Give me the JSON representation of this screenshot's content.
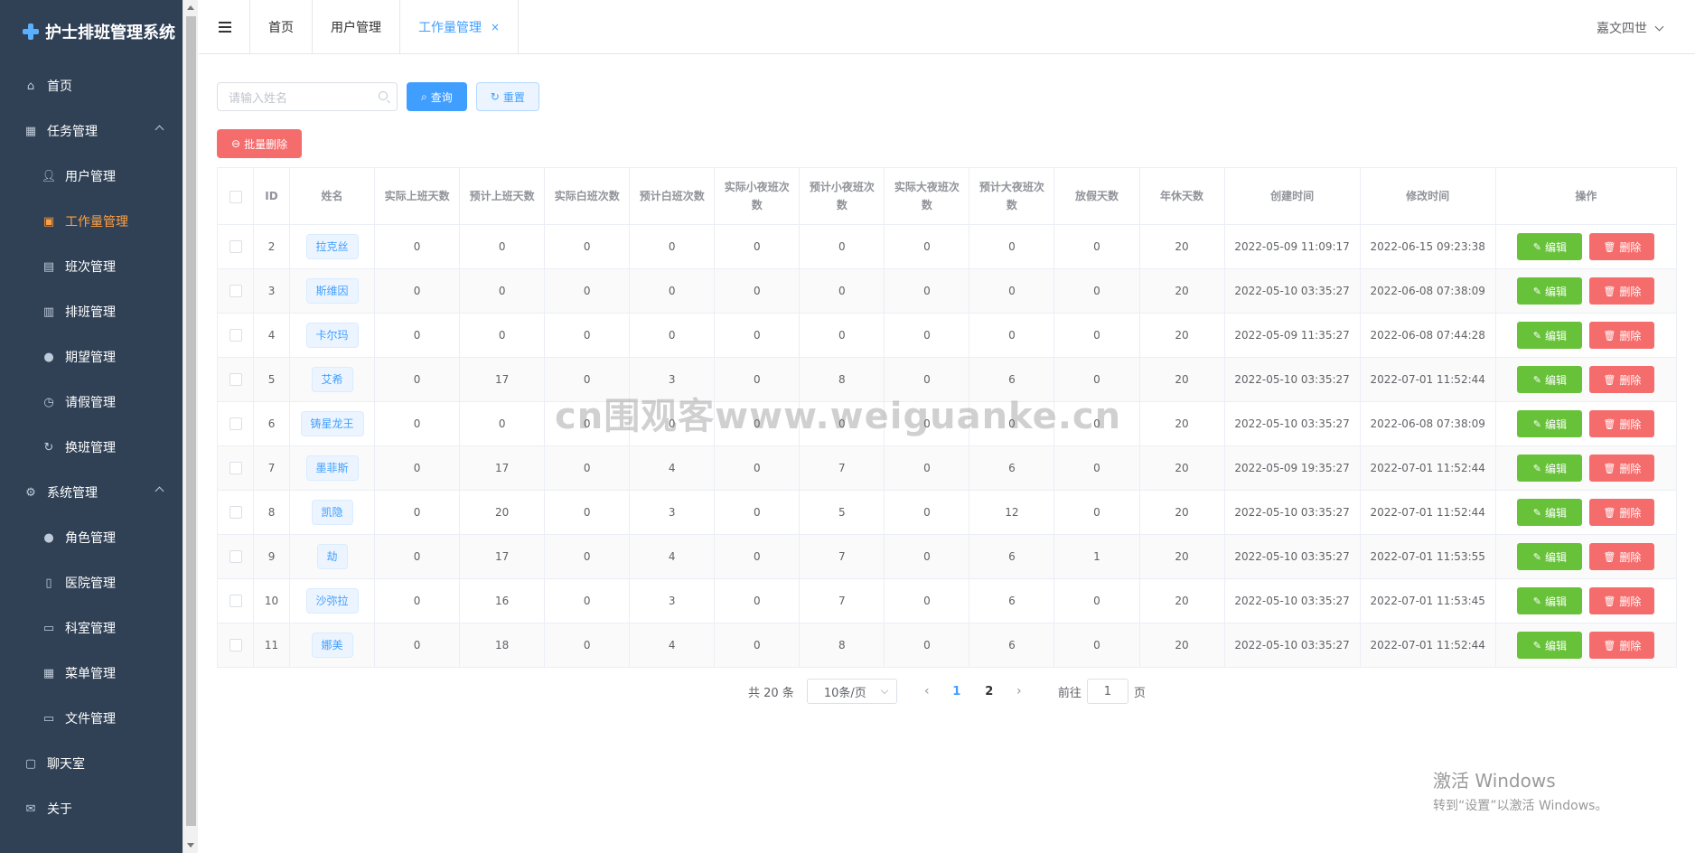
{
  "app": {
    "title": "护士排班管理系统"
  },
  "sidebar": {
    "items": [
      {
        "label": "首页",
        "icon": "home-icon"
      },
      {
        "label": "任务管理",
        "icon": "grid-icon"
      },
      {
        "label": "用户管理",
        "icon": "user-icon"
      },
      {
        "label": "工作量管理",
        "icon": "clipboard-icon"
      },
      {
        "label": "班次管理",
        "icon": "clipboard-icon"
      },
      {
        "label": "排班管理",
        "icon": "calendar-icon"
      },
      {
        "label": "期望管理",
        "icon": "location-icon"
      },
      {
        "label": "请假管理",
        "icon": "clock-icon"
      },
      {
        "label": "换班管理",
        "icon": "refresh-icon"
      },
      {
        "label": "系统管理",
        "icon": "gear-icon"
      },
      {
        "label": "角色管理",
        "icon": "user-icon"
      },
      {
        "label": "医院管理",
        "icon": "building-icon"
      },
      {
        "label": "科室管理",
        "icon": "office-icon"
      },
      {
        "label": "菜单管理",
        "icon": "menu-grid-icon"
      },
      {
        "label": "文件管理",
        "icon": "folder-icon"
      },
      {
        "label": "聊天室",
        "icon": "chat-icon"
      },
      {
        "label": "关于",
        "icon": "mail-icon"
      }
    ]
  },
  "header": {
    "tabs": [
      "首页",
      "用户管理",
      "工作量管理"
    ],
    "close_glyph": "×",
    "user": "嘉文四世"
  },
  "search": {
    "placeholder": "请输入姓名",
    "query_label": "查询",
    "reset_label": "重置"
  },
  "batch_delete_label": "批量删除",
  "table": {
    "columns": [
      "ID",
      "姓名",
      "实际上班天数",
      "预计上班天数",
      "实际白班次数",
      "预计白班次数",
      "实际小夜班次数",
      "预计小夜班次数",
      "实际大夜班次数",
      "预计大夜班次数",
      "放假天数",
      "年休天数",
      "创建时间",
      "修改时间",
      "操作"
    ],
    "edit_label": "编辑",
    "delete_label": "删除",
    "rows": [
      [
        "2",
        "拉克丝",
        "0",
        "0",
        "0",
        "0",
        "0",
        "0",
        "0",
        "0",
        "0",
        "20",
        "2022-05-09 11:09:17",
        "2022-06-15 09:23:38"
      ],
      [
        "3",
        "斯维因",
        "0",
        "0",
        "0",
        "0",
        "0",
        "0",
        "0",
        "0",
        "0",
        "20",
        "2022-05-10 03:35:27",
        "2022-06-08 07:38:09"
      ],
      [
        "4",
        "卡尔玛",
        "0",
        "0",
        "0",
        "0",
        "0",
        "0",
        "0",
        "0",
        "0",
        "20",
        "2022-05-09 11:35:27",
        "2022-06-08 07:44:28"
      ],
      [
        "5",
        "艾希",
        "0",
        "17",
        "0",
        "3",
        "0",
        "8",
        "0",
        "6",
        "0",
        "20",
        "2022-05-10 03:35:27",
        "2022-07-01 11:52:44"
      ],
      [
        "6",
        "铸星龙王",
        "0",
        "0",
        "0",
        "0",
        "0",
        "0",
        "0",
        "0",
        "0",
        "20",
        "2022-05-10 03:35:27",
        "2022-06-08 07:38:09"
      ],
      [
        "7",
        "墨菲斯",
        "0",
        "17",
        "0",
        "4",
        "0",
        "7",
        "0",
        "6",
        "0",
        "20",
        "2022-05-09 19:35:27",
        "2022-07-01 11:52:44"
      ],
      [
        "8",
        "凯隐",
        "0",
        "20",
        "0",
        "3",
        "0",
        "5",
        "0",
        "12",
        "0",
        "20",
        "2022-05-10 03:35:27",
        "2022-07-01 11:52:44"
      ],
      [
        "9",
        "劫",
        "0",
        "17",
        "0",
        "4",
        "0",
        "7",
        "0",
        "6",
        "1",
        "20",
        "2022-05-10 03:35:27",
        "2022-07-01 11:53:55"
      ],
      [
        "10",
        "沙弥拉",
        "0",
        "16",
        "0",
        "3",
        "0",
        "7",
        "0",
        "6",
        "0",
        "20",
        "2022-05-10 03:35:27",
        "2022-07-01 11:53:45"
      ],
      [
        "11",
        "娜美",
        "0",
        "18",
        "0",
        "4",
        "0",
        "8",
        "0",
        "6",
        "0",
        "20",
        "2022-05-10 03:35:27",
        "2022-07-01 11:52:44"
      ]
    ]
  },
  "pagination": {
    "total": "共 20 条",
    "page_size": "10条/页",
    "pages": [
      "1",
      "2"
    ],
    "current": "1",
    "goto_label": "前往",
    "goto_value": "1",
    "page_suffix": "页"
  },
  "watermark": "cn围观客www.weiguanke.cn",
  "activate": {
    "line1": "激活 Windows",
    "line2": "转到“设置”以激活 Windows。"
  },
  "colors": {
    "sidebar_bg": "#304156",
    "active": "#ff9f43",
    "primary": "#409eff",
    "success": "#67c23a",
    "danger": "#f56c6c"
  }
}
